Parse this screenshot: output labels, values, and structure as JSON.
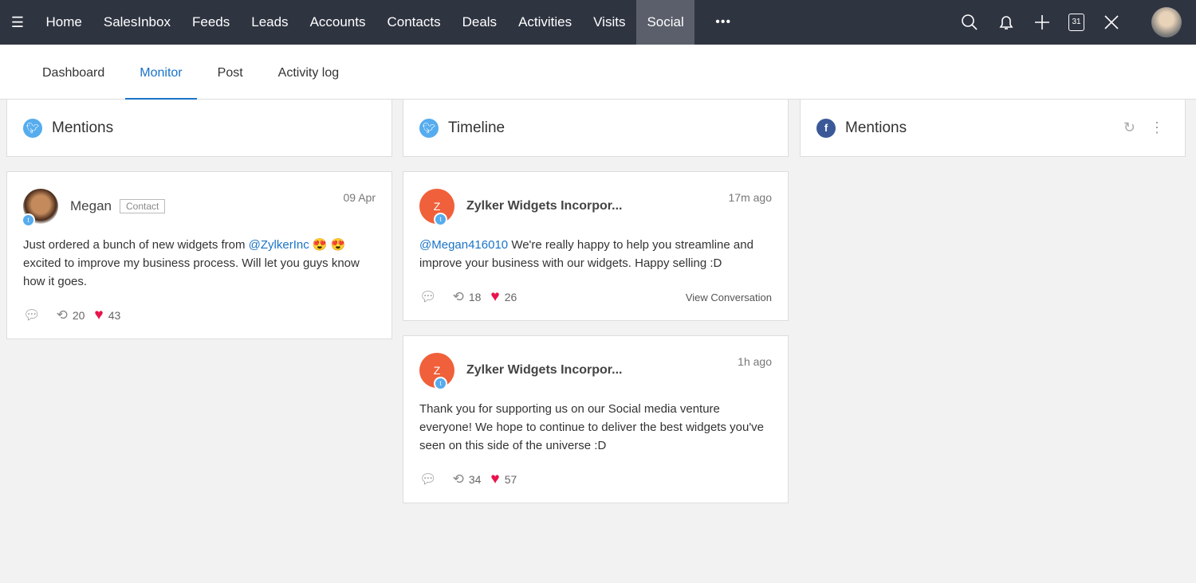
{
  "nav": {
    "items": [
      "Home",
      "SalesInbox",
      "Feeds",
      "Leads",
      "Accounts",
      "Contacts",
      "Deals",
      "Activities",
      "Visits",
      "Social"
    ],
    "active": "Social",
    "more": "•••",
    "calendar_day": "31"
  },
  "subtabs": [
    "Dashboard",
    "Monitor",
    "Post",
    "Activity log"
  ],
  "columns": [
    {
      "title": "Mentions",
      "network": "twitter"
    },
    {
      "title": "Timeline",
      "network": "twitter"
    },
    {
      "title": "Mentions",
      "network": "facebook"
    }
  ],
  "mentions": [
    {
      "name": "Megan",
      "badge": "Contact",
      "time": "09 Apr",
      "text_before": "Just ordered a bunch of new widgets from ",
      "mention": "@ZylkerInc",
      "text_after": " 😍 😍 excited to improve my business process. Will let you guys know how it goes.",
      "retweets": "20",
      "likes": "43"
    }
  ],
  "timeline": [
    {
      "initial": "Z",
      "name": "Zylker Widgets Incorpor...",
      "time": "17m ago",
      "mention": "@Megan416010",
      "text": " We're really happy to help you streamline and improve your business with our widgets. Happy selling :D",
      "retweets": "18",
      "likes": "26",
      "view": "View Conversation"
    },
    {
      "initial": "Z",
      "name": "Zylker Widgets Incorpor...",
      "time": "1h ago",
      "text": "Thank you for supporting us on our Social media venture everyone! We hope to continue to deliver the best widgets you've seen on this side of the universe :D",
      "retweets": "34",
      "likes": "57"
    }
  ]
}
